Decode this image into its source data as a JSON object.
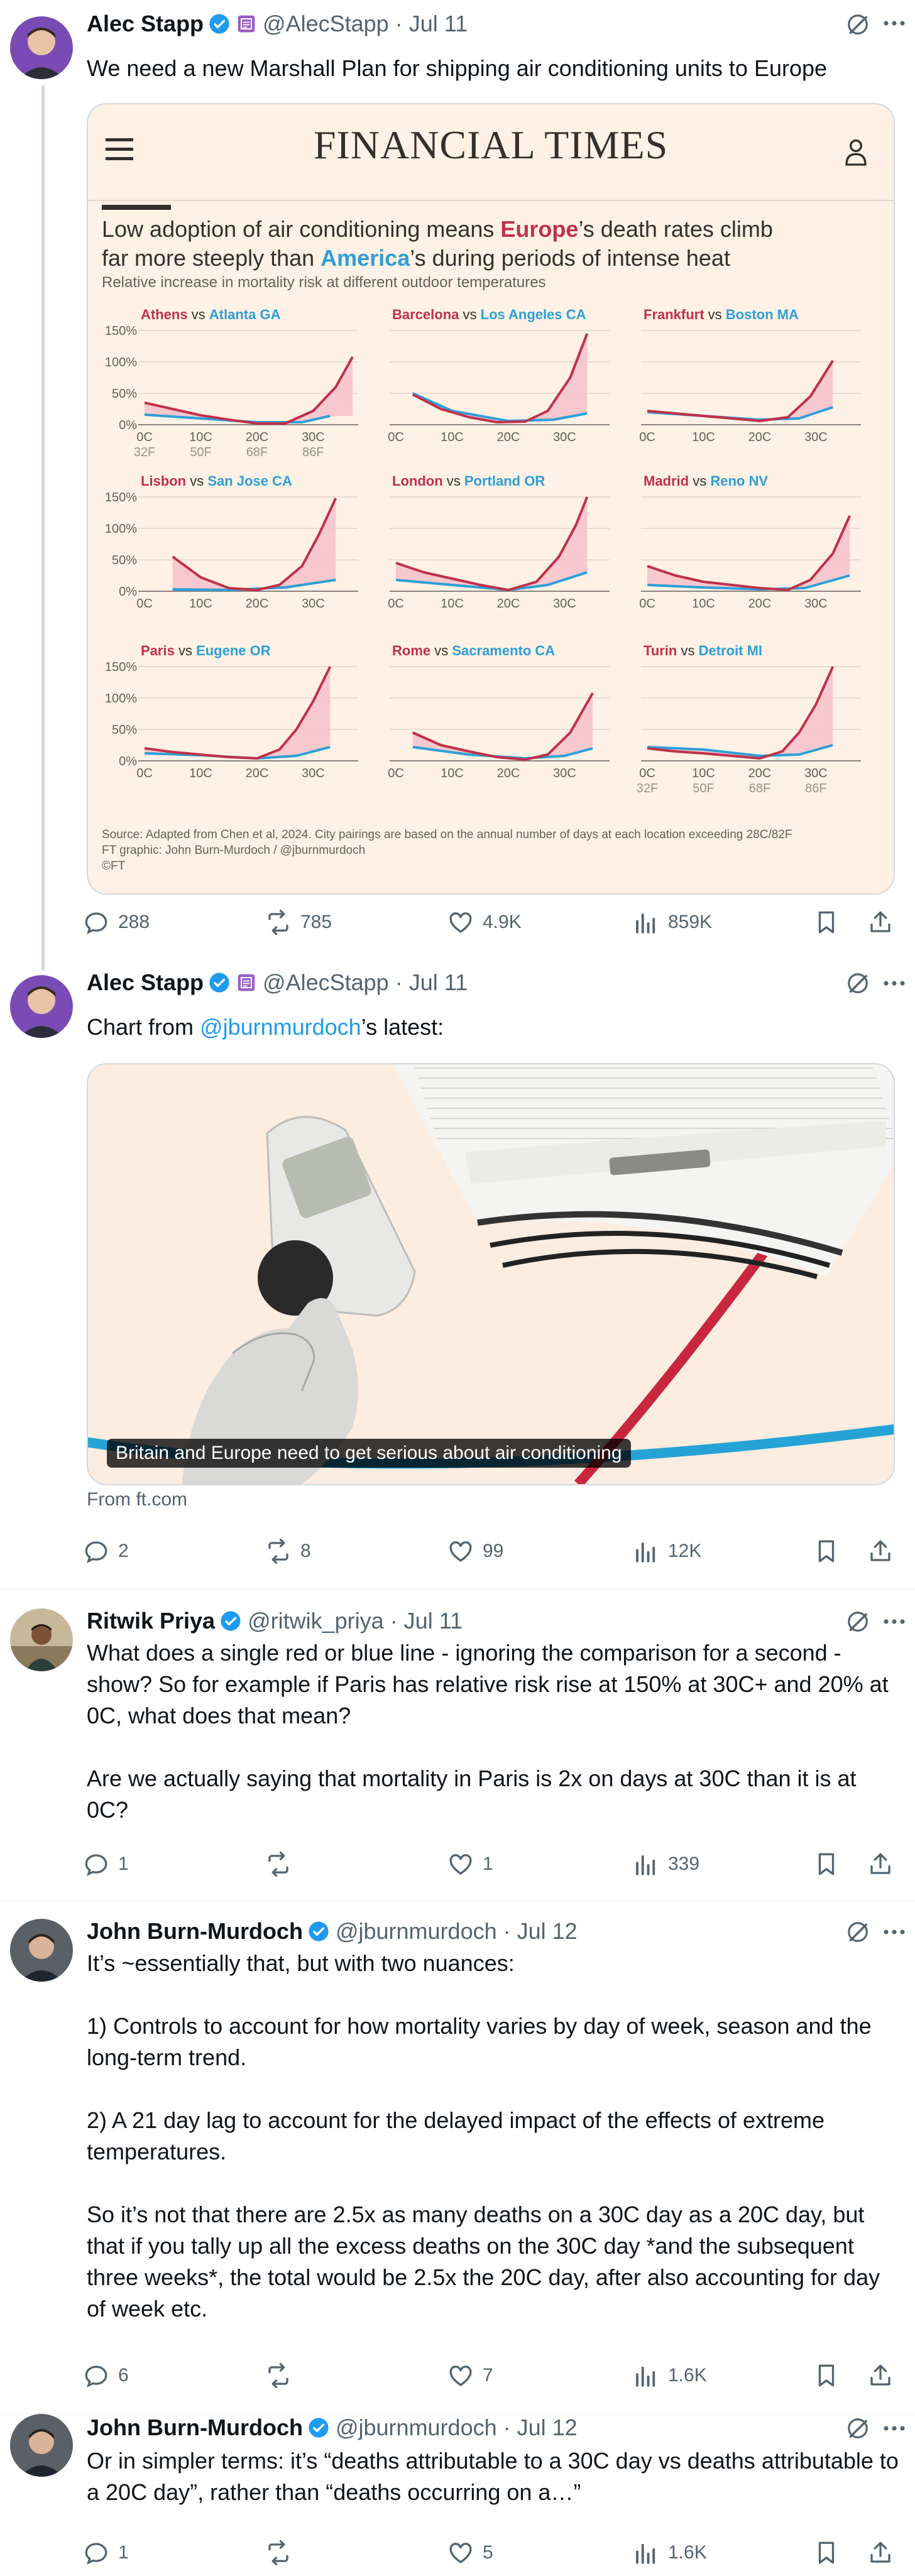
{
  "tweets": [
    {
      "name": "Alec Stapp",
      "handle": "@AlecStapp",
      "date": "· Jul 11",
      "text": "We need a new Marshall Plan for shipping air conditioning units to Europe",
      "counts": {
        "replies": "288",
        "reposts": "785",
        "likes": "4.9K",
        "views": "859K"
      }
    },
    {
      "name": "Alec Stapp",
      "handle": "@AlecStapp",
      "date": "· Jul 11",
      "text_before": "Chart from ",
      "mention": "@jburnmurdoch",
      "text_after": "’s latest:",
      "link_card": {
        "caption": "Britain and Europe need to get serious about air conditioning",
        "source": "From ft.com"
      },
      "counts": {
        "replies": "2",
        "reposts": "8",
        "likes": "99",
        "views": "12K"
      }
    },
    {
      "name": "Ritwik Priya",
      "handle": "@ritwik_priya",
      "date": "· Jul 11",
      "text": "What does a single red or blue line - ignoring the comparison for a second - show? So for example if Paris has relative risk rise at 150% at 30C+ and 20% at 0C, what does that mean?\n\nAre we actually saying that mortality in Paris is 2x on days at 30C than it is at 0C?",
      "counts": {
        "replies": "1",
        "reposts": "",
        "likes": "1",
        "views": "339"
      }
    },
    {
      "name": "John Burn-Murdoch",
      "handle": "@jburnmurdoch",
      "date": "· Jul 12",
      "text": "It’s ~essentially that, but with two nuances:\n\n1) Controls to account for how mortality varies by day of week, season and the long-term trend.\n\n2) A 21 day lag to account for the delayed impact of the effects of extreme temperatures.\n\nSo it’s not that there are 2.5x as many deaths on a 30C day as a 20C day, but that if you tally up all the excess deaths on the 30C day *and the subsequent three weeks*, the total would be 2.5x the 20C day, after also accounting for day of week etc.",
      "counts": {
        "replies": "6",
        "reposts": "",
        "likes": "7",
        "views": "1.6K"
      }
    },
    {
      "name": "John Burn-Murdoch",
      "handle": "@jburnmurdoch",
      "date": "· Jul 12",
      "text": "Or in simpler terms: it’s “deaths attributable to a 30C day vs deaths attributable to a 20C day”, rather than “deaths occurring on a…”",
      "counts": {
        "replies": "1",
        "reposts": "",
        "likes": "5",
        "views": "1.6K"
      }
    }
  ],
  "ft_chart": {
    "masthead": "FINANCIAL TIMES",
    "title_part1": "Low adoption of air conditioning means ",
    "title_europe": "Europe",
    "title_part2": "’s death rates climb",
    "title_part3": "far more steeply than ",
    "title_america": "America",
    "title_part4": "’s during periods of intense heat",
    "subtitle": "Relative increase in mortality risk at different outdoor temperatures",
    "source_line1": "Source: Adapted from Chen et al, 2024. City pairings are based on the annual number of days at each location exceeding 28C/82F",
    "source_line2": "FT graphic: John Burn-Murdoch / @jburnmurdoch",
    "source_line3": "©FT",
    "colors": {
      "europe": "#c0314a",
      "america": "#2e9fd6",
      "fill": "#f7c1cb",
      "bg": "#fff1e5"
    }
  },
  "chart_data": {
    "type": "line",
    "title": "Low adoption of air conditioning means Europe’s death rates climb far more steeply than America’s during periods of intense heat",
    "subtitle": "Relative increase in mortality risk at different outdoor temperatures",
    "y_ticks": [
      "150%",
      "100%",
      "50%",
      "0%"
    ],
    "x_ticks_c": [
      "0C",
      "10C",
      "20C",
      "30C"
    ],
    "x_ticks_f": [
      "32F",
      "50F",
      "68F",
      "86F"
    ],
    "x_range_c": [
      0,
      38
    ],
    "y_range_pct": [
      0,
      150
    ],
    "vs": "vs",
    "panels": [
      {
        "eu": "Athens",
        "us": "Atlanta GA",
        "show_y": true,
        "show_f": true,
        "eu_x": [
          0,
          5,
          10,
          15,
          20,
          25,
          30,
          34,
          37
        ],
        "eu_y": [
          35,
          25,
          15,
          8,
          2,
          2,
          22,
          60,
          108
        ],
        "us_x": [
          0,
          10,
          20,
          28,
          33
        ],
        "us_y": [
          16,
          10,
          4,
          4,
          14
        ]
      },
      {
        "eu": "Barcelona",
        "us": "Los Angeles CA",
        "show_y": false,
        "show_f": false,
        "eu_x": [
          3,
          8,
          13,
          18,
          23,
          27,
          31,
          34
        ],
        "eu_y": [
          48,
          25,
          12,
          4,
          5,
          22,
          75,
          145
        ],
        "us_x": [
          3,
          10,
          20,
          28,
          34
        ],
        "us_y": [
          50,
          22,
          6,
          8,
          18
        ]
      },
      {
        "eu": "Frankfurt",
        "us": "Boston MA",
        "show_y": false,
        "show_f": false,
        "eu_x": [
          0,
          5,
          10,
          15,
          20,
          25,
          29,
          33
        ],
        "eu_y": [
          22,
          18,
          14,
          10,
          6,
          12,
          45,
          102
        ],
        "us_x": [
          0,
          10,
          20,
          27,
          33
        ],
        "us_y": [
          20,
          14,
          8,
          10,
          28
        ]
      },
      {
        "eu": "Lisbon",
        "us": "San Jose CA",
        "show_y": true,
        "show_f": false,
        "eu_x": [
          5,
          10,
          15,
          20,
          24,
          28,
          31,
          34
        ],
        "eu_y": [
          55,
          22,
          5,
          2,
          10,
          40,
          90,
          148
        ],
        "us_x": [
          5,
          15,
          25,
          34
        ],
        "us_y": [
          3,
          2,
          6,
          18
        ]
      },
      {
        "eu": "London",
        "us": "Portland OR",
        "show_y": false,
        "show_f": false,
        "eu_x": [
          0,
          5,
          10,
          15,
          20,
          25,
          29,
          32,
          34
        ],
        "eu_y": [
          45,
          30,
          20,
          10,
          2,
          15,
          55,
          105,
          150
        ],
        "us_x": [
          0,
          10,
          20,
          27,
          34
        ],
        "us_y": [
          18,
          10,
          2,
          10,
          30
        ]
      },
      {
        "eu": "Madrid",
        "us": "Reno NV",
        "show_y": false,
        "show_f": false,
        "eu_x": [
          0,
          5,
          10,
          15,
          20,
          25,
          29,
          33,
          36
        ],
        "eu_y": [
          40,
          25,
          15,
          10,
          5,
          2,
          18,
          60,
          120
        ],
        "us_x": [
          0,
          10,
          20,
          28,
          36
        ],
        "us_y": [
          10,
          6,
          3,
          5,
          25
        ]
      },
      {
        "eu": "Paris",
        "us": "Eugene OR",
        "show_y": true,
        "show_f": false,
        "eu_x": [
          0,
          5,
          10,
          15,
          20,
          24,
          27,
          30,
          33
        ],
        "eu_y": [
          20,
          14,
          10,
          6,
          4,
          18,
          50,
          95,
          150
        ],
        "us_x": [
          0,
          10,
          20,
          27,
          33
        ],
        "us_y": [
          12,
          9,
          4,
          8,
          22
        ]
      },
      {
        "eu": "Rome",
        "us": "Sacramento CA",
        "show_y": false,
        "show_f": false,
        "eu_x": [
          3,
          8,
          13,
          18,
          23,
          27,
          31,
          35
        ],
        "eu_y": [
          45,
          25,
          15,
          6,
          2,
          10,
          45,
          108
        ],
        "us_x": [
          3,
          13,
          23,
          30,
          35
        ],
        "us_y": [
          22,
          10,
          4,
          8,
          20
        ]
      },
      {
        "eu": "Turin",
        "us": "Detroit MI",
        "show_y": false,
        "show_f": true,
        "eu_x": [
          0,
          5,
          10,
          15,
          20,
          24,
          27,
          30,
          33
        ],
        "eu_y": [
          20,
          15,
          12,
          8,
          4,
          15,
          45,
          90,
          150
        ],
        "us_x": [
          0,
          10,
          20,
          27,
          33
        ],
        "us_y": [
          22,
          18,
          8,
          10,
          25
        ]
      }
    ]
  }
}
